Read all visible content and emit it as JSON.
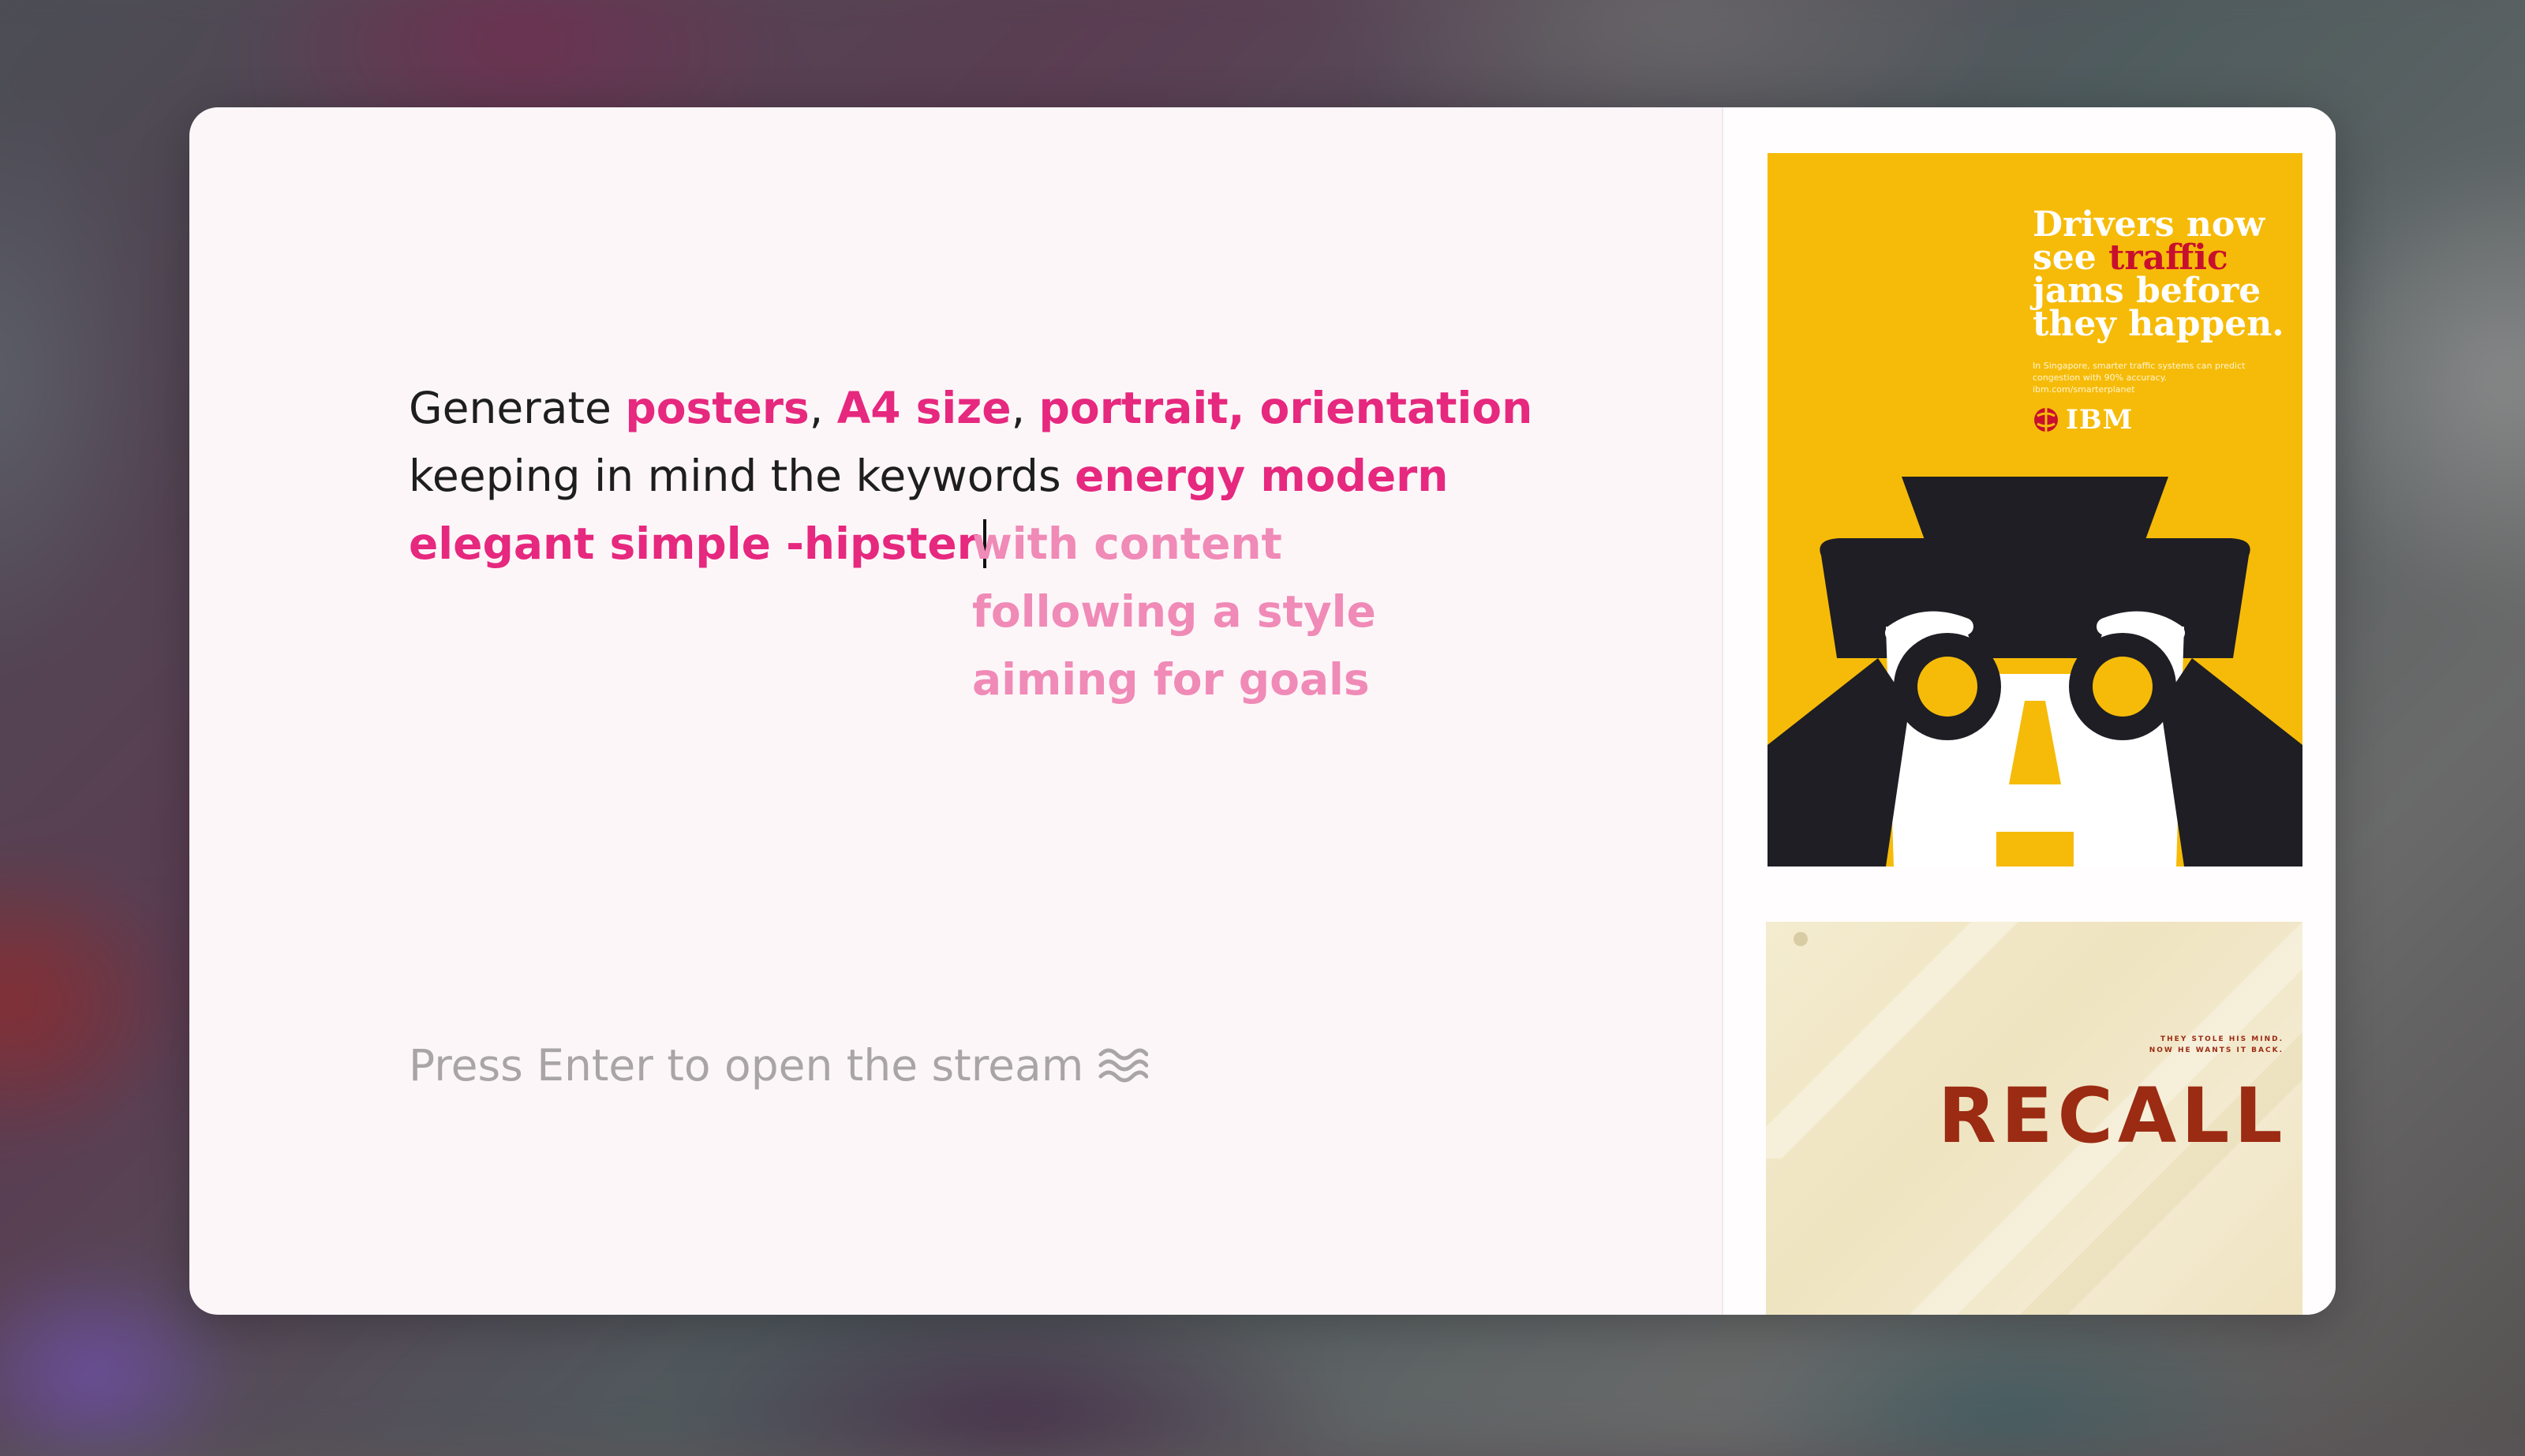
{
  "prompt": {
    "word_generate": "Generate",
    "kw_posters": "posters",
    "comma1": ",",
    "kw_a4": "A4 size",
    "comma2": ",",
    "kw_portrait": "portrait, orientation",
    "line2_plain": "keeping in mind the keywords",
    "kw_energy": "energy modern",
    "kw_elegant": "elegant simple -hipster"
  },
  "suggestions": [
    "with content",
    "following a style",
    "aiming for goals"
  ],
  "hint": {
    "text": "Press Enter to open the stream",
    "icon": "wave-icon"
  },
  "posters": {
    "ibm": {
      "headline_1": "Drivers now",
      "headline_2_a": "see",
      "headline_2_b": "traffic",
      "headline_3": "jams before",
      "headline_4": "they happen.",
      "small_text": "In Singapore, smarter traffic systems can predict congestion with 90% accuracy. ibm.com/smarterplanet",
      "logo": "IBM"
    },
    "recall": {
      "tagline_1": "THEY STOLE HIS MIND.",
      "tagline_2": "NOW HE WANTS IT BACK.",
      "title": "RECALL"
    }
  },
  "colors": {
    "keyword": "#e6287f",
    "suggestion": "#f08ab7",
    "hint": "#a9a5a7",
    "ibm_yellow": "#f6bb08",
    "recall_red": "#9b2b12"
  }
}
